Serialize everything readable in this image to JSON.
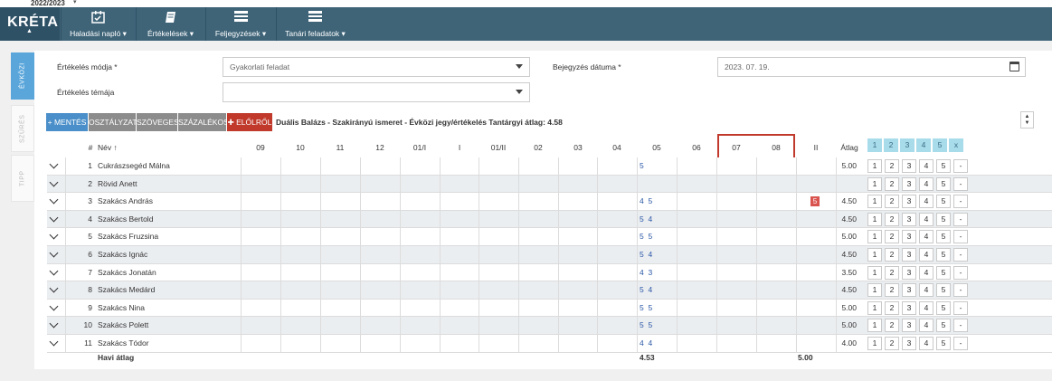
{
  "top": {
    "year": "2022/2023"
  },
  "nav": {
    "logo": "KRÉTA",
    "items": [
      {
        "label": "Haladási napló ▾",
        "icon": "calendar-icon"
      },
      {
        "label": "Értékelések ▾",
        "icon": "book-icon"
      },
      {
        "label": "Feljegyzések ▾",
        "icon": "list-icon"
      },
      {
        "label": "Tanári feladatok ▾",
        "icon": "list-icon"
      }
    ]
  },
  "side_tabs": [
    "ÉVKÖZI",
    "SZŰRÉS",
    "TIPP"
  ],
  "form": {
    "mode_label": "Értékelés módja *",
    "mode_value": "Gyakorlati feladat",
    "topic_label": "Értékelés témája",
    "topic_value": "",
    "date_label": "Bejegyzés dátuma *",
    "date_value": "2023. 07. 19."
  },
  "toolbar": {
    "save": "+ MENTÉS",
    "class": "OSZTÁLYZAT",
    "text": "SZÖVEGES",
    "percent": "SZÁZALÉKOS",
    "reset": "✚ ELŐLRŐL",
    "info": "Duális Balázs - Szakirányú ismeret - Évközi jegy/értékelés  Tantárgyi átlag: 4.58"
  },
  "table": {
    "header": {
      "num": "#",
      "name": "Név ↑",
      "avg": "Átlag"
    },
    "columns": [
      "09",
      "10",
      "11",
      "12",
      "01/I",
      "I",
      "01/II",
      "02",
      "03",
      "04",
      "05",
      "06",
      "07",
      "08",
      "II"
    ],
    "grade_buttons": [
      "1",
      "2",
      "3",
      "4",
      "5",
      "x"
    ],
    "quick_buttons": [
      "1",
      "2",
      "3",
      "4",
      "5",
      "-"
    ],
    "rows": [
      {
        "n": "1",
        "name": "Cukrászsegéd Málna",
        "g05": "5",
        "g_ii": "",
        "avg": "5.00"
      },
      {
        "n": "2",
        "name": "Rövid Anett",
        "g05": "",
        "g_ii": "",
        "avg": ""
      },
      {
        "n": "3",
        "name": "Szakács András",
        "g05": "4  5",
        "g_ii": "5",
        "avg": "4.50"
      },
      {
        "n": "4",
        "name": "Szakács Bertold",
        "g05": "5  4",
        "g_ii": "",
        "avg": "4.50"
      },
      {
        "n": "5",
        "name": "Szakács Fruzsina",
        "g05": "5  5",
        "g_ii": "",
        "avg": "5.00"
      },
      {
        "n": "6",
        "name": "Szakács Ignác",
        "g05": "5  4",
        "g_ii": "",
        "avg": "4.50"
      },
      {
        "n": "7",
        "name": "Szakács Jonatán",
        "g05": "4  3",
        "g_ii": "",
        "avg": "3.50"
      },
      {
        "n": "8",
        "name": "Szakács Medárd",
        "g05": "5  4",
        "g_ii": "",
        "avg": "4.50"
      },
      {
        "n": "9",
        "name": "Szakács Nina",
        "g05": "5  5",
        "g_ii": "",
        "avg": "5.00"
      },
      {
        "n": "10",
        "name": "Szakács Polett",
        "g05": "5  5",
        "g_ii": "",
        "avg": "5.00"
      },
      {
        "n": "11",
        "name": "Szakács Tódor",
        "g05": "4  4",
        "g_ii": "",
        "avg": "4.00"
      }
    ],
    "footer": {
      "label": "Havi átlag",
      "avg05": "4.53",
      "avg_ii": "5.00"
    }
  },
  "colors": {
    "navbar": "#3f6478",
    "accent": "#5aa6db",
    "save": "#4a8fc9",
    "reset": "#c0392b",
    "grade": "#2a57a7"
  }
}
